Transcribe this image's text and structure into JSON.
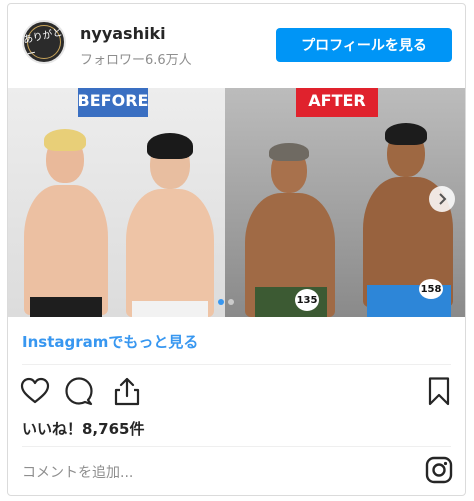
{
  "header": {
    "username": "nyyashiki",
    "followers": "フォロワー6.6万人",
    "profile_button": "プロフィールを見る",
    "avatar_text": "ありがとー"
  },
  "photo": {
    "before_label": "BEFORE",
    "after_label": "AFTER",
    "bib_left": "135",
    "bib_right": "158",
    "slide_count": 2,
    "active_slide": 1
  },
  "more_link": "Instagramでもっと見る",
  "likes": "いいね！8,765件",
  "comment_placeholder": "コメントを追加...",
  "icons": [
    "heart-icon",
    "comment-icon",
    "share-icon",
    "bookmark-icon",
    "instagram-icon",
    "chevron-right-icon"
  ]
}
